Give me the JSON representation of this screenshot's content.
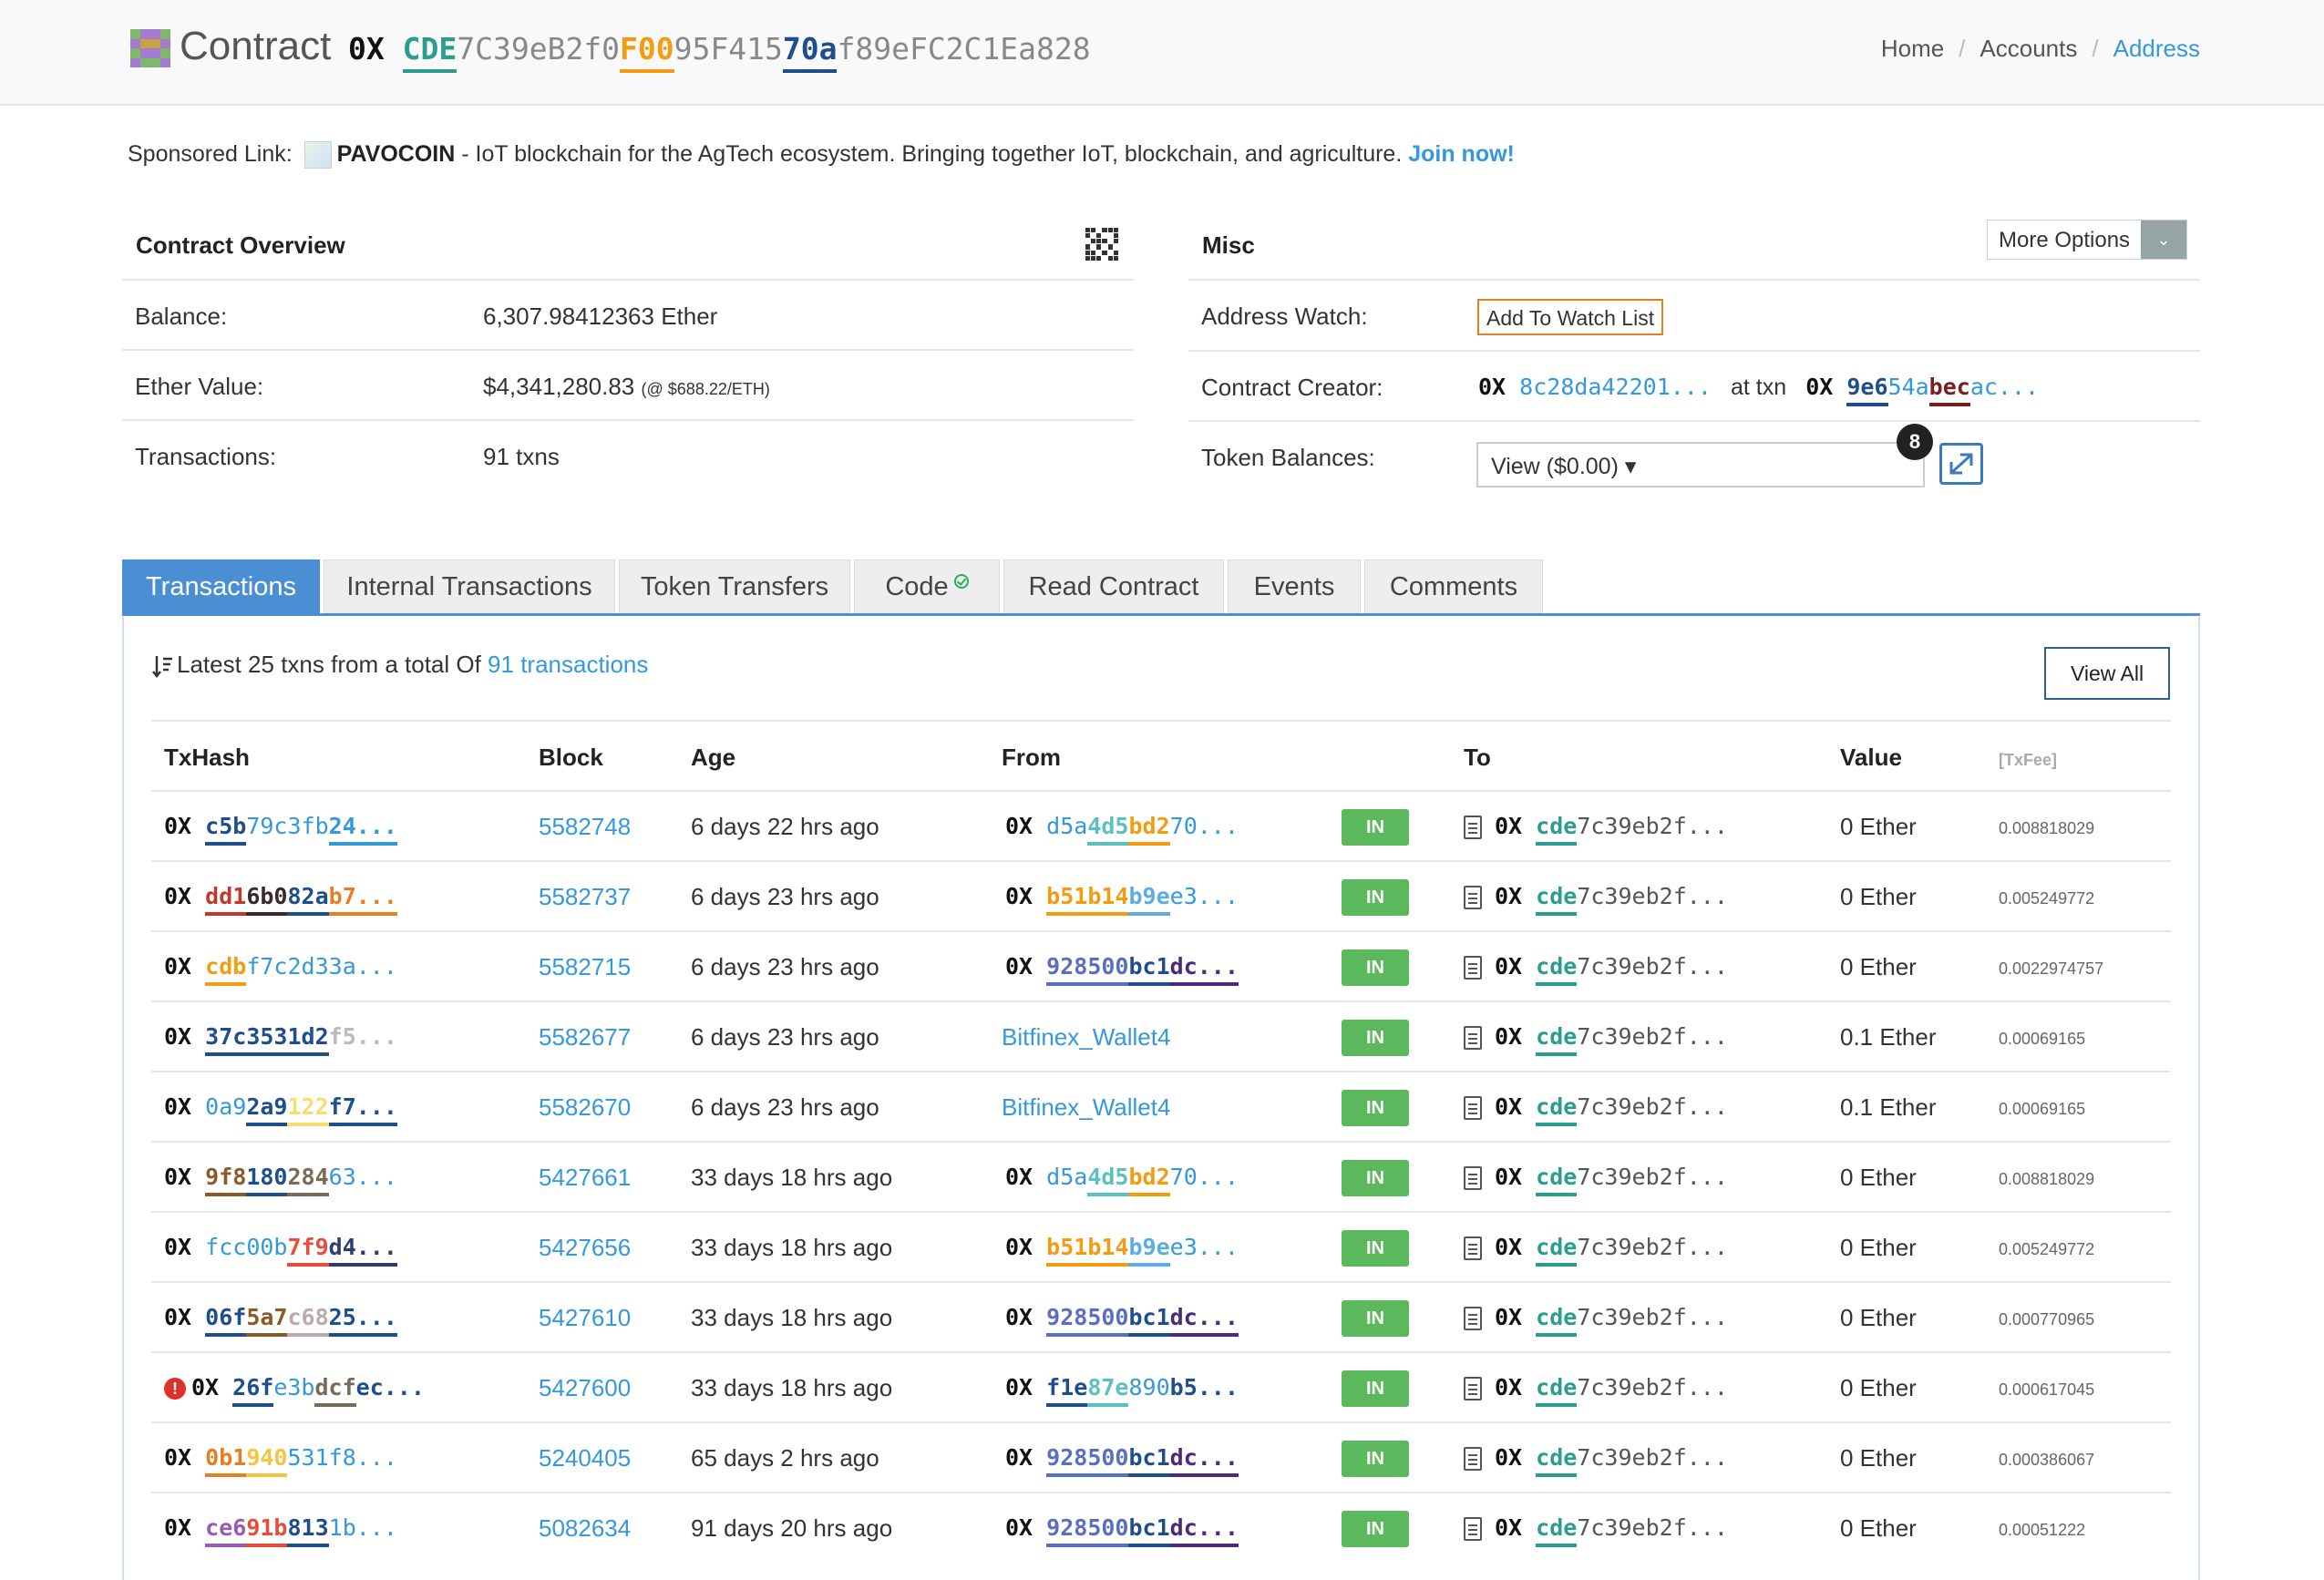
{
  "header": {
    "title": "Contract",
    "address_prefix": "0X",
    "address_segments": [
      {
        "text": "CDE",
        "color": "#2a9d8f",
        "bold": true,
        "underline": true
      },
      {
        "text": "7C39eB2f0",
        "color": "#888888",
        "bold": false,
        "underline": false
      },
      {
        "text": "F00",
        "color": "#f39c12",
        "bold": true,
        "underline": true
      },
      {
        "text": "95F415",
        "color": "#888888",
        "bold": false,
        "underline": false
      },
      {
        "text": "70a",
        "color": "#1f4e8c",
        "bold": true,
        "underline": true
      },
      {
        "text": "f89eFC2C1Ea828",
        "color": "#888888",
        "bold": false,
        "underline": false
      }
    ],
    "logo_icon": "contract-identicon",
    "breadcrumb": {
      "home": "Home",
      "accounts": "Accounts",
      "address": "Address",
      "separator": "/"
    }
  },
  "sponsored": {
    "label": "Sponsored Link:",
    "name": "PAVOCOIN",
    "text": " - IoT blockchain for the AgTech ecosystem. Bringing together IoT, blockchain, and agriculture. ",
    "cta": "Join now!"
  },
  "overview": {
    "title": "Contract Overview",
    "qr_icon": "qr-code-icon",
    "balance_label": "Balance:",
    "balance_value": "6,307.98412363 Ether",
    "ether_value_label": "Ether Value:",
    "ether_value": "$4,341,280.83",
    "ether_rate": "(@ $688.22/ETH)",
    "transactions_label": "Transactions:",
    "transactions_value": "91 txns"
  },
  "misc": {
    "title": "Misc",
    "more_options": "More Options",
    "address_watch_label": "Address Watch:",
    "watch_button": "Add To Watch List",
    "creator_label": "Contract Creator:",
    "creator_addr": [
      {
        "text": "8c2",
        "color": "#3498db",
        "bold": false,
        "underline": false
      },
      {
        "text": "8da",
        "color": "#3498db",
        "bold": false,
        "underline": false
      },
      {
        "text": "422",
        "color": "#3498db",
        "bold": false,
        "underline": false
      },
      {
        "text": "01...",
        "color": "#3498db",
        "bold": false,
        "underline": false
      }
    ],
    "at_txn": "at txn",
    "creator_txn": [
      {
        "text": "9e6",
        "color": "#1f4e8c",
        "bold": true,
        "underline": true
      },
      {
        "text": "54a",
        "color": "#3498db",
        "bold": false,
        "underline": false
      },
      {
        "text": "bec",
        "color": "#7a1f1f",
        "bold": true,
        "underline": true
      },
      {
        "text": "ac...",
        "color": "#3498db",
        "bold": false,
        "underline": false
      }
    ],
    "token_label": "Token Balances:",
    "token_value": "View ($0.00) ▾",
    "token_count": "8"
  },
  "tabs": [
    "Transactions",
    "Internal Transactions",
    "Token Transfers",
    "Code",
    "Read Contract",
    "Events",
    "Comments"
  ],
  "list": {
    "summary_prefix": "Latest 25 txns from a total Of ",
    "summary_link": "91 transactions",
    "view_all": "View All"
  },
  "table": {
    "headers": {
      "txhash": "TxHash",
      "block": "Block",
      "age": "Age",
      "from": "From",
      "to": "To",
      "value": "Value",
      "fee": "[TxFee]"
    },
    "direction_label": "IN",
    "rows": [
      {
        "error": false,
        "hash": [
          {
            "text": "c5b",
            "color": "#1f4e8c",
            "bold": true,
            "underline": true
          },
          {
            "text": "79c",
            "color": "#3498db",
            "bold": false,
            "underline": false
          },
          {
            "text": "3fb",
            "color": "#3498db",
            "bold": false,
            "underline": false
          },
          {
            "text": "24...",
            "color": "#3498db",
            "bold": true,
            "underline": true
          }
        ],
        "block": "5582748",
        "age": "6 days 22 hrs ago",
        "from_text": "",
        "from": [
          {
            "text": "d5a",
            "color": "#3498db",
            "bold": false,
            "underline": false
          },
          {
            "text": "4d5",
            "color": "#5bc0be",
            "bold": true,
            "underline": true
          },
          {
            "text": "bd2",
            "color": "#f39c12",
            "bold": true,
            "underline": true
          },
          {
            "text": "70...",
            "color": "#3498db",
            "bold": false,
            "underline": false
          }
        ],
        "value": "0 Ether",
        "fee": "0.008818029"
      },
      {
        "error": false,
        "hash": [
          {
            "text": "dd1",
            "color": "#c0392b",
            "bold": true,
            "underline": true
          },
          {
            "text": "6b0",
            "color": "#3b2a2a",
            "bold": true,
            "underline": true
          },
          {
            "text": "82a",
            "color": "#1f4e8c",
            "bold": true,
            "underline": true
          },
          {
            "text": "b7...",
            "color": "#e67e22",
            "bold": true,
            "underline": true
          }
        ],
        "block": "5582737",
        "age": "6 days 23 hrs ago",
        "from_text": "",
        "from": [
          {
            "text": "b51",
            "color": "#f39c12",
            "bold": true,
            "underline": true
          },
          {
            "text": "b14",
            "color": "#f39c12",
            "bold": true,
            "underline": true
          },
          {
            "text": "b9e",
            "color": "#5dade2",
            "bold": true,
            "underline": true
          },
          {
            "text": "e3...",
            "color": "#3498db",
            "bold": false,
            "underline": false
          }
        ],
        "value": "0 Ether",
        "fee": "0.005249772"
      },
      {
        "error": false,
        "hash": [
          {
            "text": "cdb",
            "color": "#f39c12",
            "bold": true,
            "underline": true
          },
          {
            "text": "f7c",
            "color": "#3498db",
            "bold": false,
            "underline": false
          },
          {
            "text": "2d3",
            "color": "#3498db",
            "bold": false,
            "underline": false
          },
          {
            "text": "3a...",
            "color": "#3498db",
            "bold": false,
            "underline": false
          }
        ],
        "block": "5582715",
        "age": "6 days 23 hrs ago",
        "from_text": "",
        "from": [
          {
            "text": "928",
            "color": "#5b6fc0",
            "bold": true,
            "underline": true
          },
          {
            "text": "500",
            "color": "#5b6fc0",
            "bold": true,
            "underline": true
          },
          {
            "text": "bc1",
            "color": "#1f4e8c",
            "bold": true,
            "underline": true
          },
          {
            "text": "dc...",
            "color": "#4b2a7a",
            "bold": true,
            "underline": true
          }
        ],
        "value": "0 Ether",
        "fee": "0.0022974757"
      },
      {
        "error": false,
        "hash": [
          {
            "text": "37c",
            "color": "#1f4e8c",
            "bold": true,
            "underline": true
          },
          {
            "text": "353",
            "color": "#1f4e8c",
            "bold": true,
            "underline": true
          },
          {
            "text": "1d2",
            "color": "#1f4e8c",
            "bold": true,
            "underline": true
          },
          {
            "text": "f5...",
            "color": "#bbbbbb",
            "bold": true,
            "underline": false
          }
        ],
        "block": "5582677",
        "age": "6 days 23 hrs ago",
        "from_text": "Bitfinex_Wallet4",
        "from": [],
        "value": "0.1 Ether",
        "fee": "0.00069165"
      },
      {
        "error": false,
        "hash": [
          {
            "text": "0a9",
            "color": "#3498db",
            "bold": false,
            "underline": false
          },
          {
            "text": "2a9",
            "color": "#1f4e8c",
            "bold": true,
            "underline": true
          },
          {
            "text": "122",
            "color": "#f7dc6f",
            "bold": true,
            "underline": true
          },
          {
            "text": "f7...",
            "color": "#1f4e8c",
            "bold": true,
            "underline": true
          }
        ],
        "block": "5582670",
        "age": "6 days 23 hrs ago",
        "from_text": "Bitfinex_Wallet4",
        "from": [],
        "value": "0.1 Ether",
        "fee": "0.00069165"
      },
      {
        "error": false,
        "hash": [
          {
            "text": "9f8",
            "color": "#8b5a2b",
            "bold": true,
            "underline": true
          },
          {
            "text": "180",
            "color": "#1f4e8c",
            "bold": true,
            "underline": true
          },
          {
            "text": "284",
            "color": "#7a6a5a",
            "bold": true,
            "underline": true
          },
          {
            "text": "63...",
            "color": "#3498db",
            "bold": false,
            "underline": false
          }
        ],
        "block": "5427661",
        "age": "33 days 18 hrs ago",
        "from_text": "",
        "from": [
          {
            "text": "d5a",
            "color": "#3498db",
            "bold": false,
            "underline": false
          },
          {
            "text": "4d5",
            "color": "#5bc0be",
            "bold": true,
            "underline": true
          },
          {
            "text": "bd2",
            "color": "#f39c12",
            "bold": true,
            "underline": true
          },
          {
            "text": "70...",
            "color": "#3498db",
            "bold": false,
            "underline": false
          }
        ],
        "value": "0 Ether",
        "fee": "0.008818029"
      },
      {
        "error": false,
        "hash": [
          {
            "text": "fcc",
            "color": "#3498db",
            "bold": false,
            "underline": false
          },
          {
            "text": "00b",
            "color": "#3498db",
            "bold": false,
            "underline": false
          },
          {
            "text": "7f9",
            "color": "#e74c3c",
            "bold": true,
            "underline": true
          },
          {
            "text": "d4...",
            "color": "#2c3e70",
            "bold": true,
            "underline": true
          }
        ],
        "block": "5427656",
        "age": "33 days 18 hrs ago",
        "from_text": "",
        "from": [
          {
            "text": "b51",
            "color": "#f39c12",
            "bold": true,
            "underline": true
          },
          {
            "text": "b14",
            "color": "#f39c12",
            "bold": true,
            "underline": true
          },
          {
            "text": "b9e",
            "color": "#5dade2",
            "bold": true,
            "underline": true
          },
          {
            "text": "e3...",
            "color": "#3498db",
            "bold": false,
            "underline": false
          }
        ],
        "value": "0 Ether",
        "fee": "0.005249772"
      },
      {
        "error": false,
        "hash": [
          {
            "text": "06f",
            "color": "#1f4e8c",
            "bold": true,
            "underline": true
          },
          {
            "text": "5a7",
            "color": "#8b5a2b",
            "bold": true,
            "underline": true
          },
          {
            "text": "c68",
            "color": "#bbaaaa",
            "bold": true,
            "underline": true
          },
          {
            "text": "25...",
            "color": "#1f4e8c",
            "bold": true,
            "underline": true
          }
        ],
        "block": "5427610",
        "age": "33 days 18 hrs ago",
        "from_text": "",
        "from": [
          {
            "text": "928",
            "color": "#5b6fc0",
            "bold": true,
            "underline": true
          },
          {
            "text": "500",
            "color": "#5b6fc0",
            "bold": true,
            "underline": true
          },
          {
            "text": "bc1",
            "color": "#1f4e8c",
            "bold": true,
            "underline": true
          },
          {
            "text": "dc...",
            "color": "#4b2a7a",
            "bold": true,
            "underline": true
          }
        ],
        "value": "0 Ether",
        "fee": "0.000770965"
      },
      {
        "error": true,
        "hash": [
          {
            "text": "26f",
            "color": "#1f4e8c",
            "bold": true,
            "underline": true
          },
          {
            "text": "e3b",
            "color": "#3498db",
            "bold": false,
            "underline": false
          },
          {
            "text": "dcf",
            "color": "#7a6a5a",
            "bold": true,
            "underline": true
          },
          {
            "text": "ec...",
            "color": "#1f4e8c",
            "bold": true,
            "underline": false
          }
        ],
        "block": "5427600",
        "age": "33 days 18 hrs ago",
        "from_text": "",
        "from": [
          {
            "text": "f1e",
            "color": "#1f4e8c",
            "bold": true,
            "underline": true
          },
          {
            "text": "87e",
            "color": "#5bc0be",
            "bold": true,
            "underline": true
          },
          {
            "text": "890",
            "color": "#3498db",
            "bold": false,
            "underline": false
          },
          {
            "text": "b5...",
            "color": "#1f4e8c",
            "bold": true,
            "underline": false
          }
        ],
        "value": "0 Ether",
        "fee": "0.000617045"
      },
      {
        "error": false,
        "hash": [
          {
            "text": "0b1",
            "color": "#e67e22",
            "bold": true,
            "underline": true
          },
          {
            "text": "940",
            "color": "#f4c542",
            "bold": true,
            "underline": true
          },
          {
            "text": "531",
            "color": "#3498db",
            "bold": false,
            "underline": false
          },
          {
            "text": "f8...",
            "color": "#3498db",
            "bold": false,
            "underline": false
          }
        ],
        "block": "5240405",
        "age": "65 days 2 hrs ago",
        "from_text": "",
        "from": [
          {
            "text": "928",
            "color": "#5b6fc0",
            "bold": true,
            "underline": true
          },
          {
            "text": "500",
            "color": "#5b6fc0",
            "bold": true,
            "underline": true
          },
          {
            "text": "bc1",
            "color": "#1f4e8c",
            "bold": true,
            "underline": true
          },
          {
            "text": "dc...",
            "color": "#4b2a7a",
            "bold": true,
            "underline": true
          }
        ],
        "value": "0 Ether",
        "fee": "0.000386067"
      },
      {
        "error": false,
        "hash": [
          {
            "text": "ce6",
            "color": "#9b59b6",
            "bold": true,
            "underline": true
          },
          {
            "text": "91b",
            "color": "#e74c3c",
            "bold": true,
            "underline": true
          },
          {
            "text": "813",
            "color": "#1f4e8c",
            "bold": true,
            "underline": true
          },
          {
            "text": "1b...",
            "color": "#3498db",
            "bold": false,
            "underline": false
          }
        ],
        "block": "5082634",
        "age": "91 days 20 hrs ago",
        "from_text": "",
        "from": [
          {
            "text": "928",
            "color": "#5b6fc0",
            "bold": true,
            "underline": true
          },
          {
            "text": "500",
            "color": "#5b6fc0",
            "bold": true,
            "underline": true
          },
          {
            "text": "bc1",
            "color": "#1f4e8c",
            "bold": true,
            "underline": true
          },
          {
            "text": "dc...",
            "color": "#4b2a7a",
            "bold": true,
            "underline": true
          }
        ],
        "value": "0 Ether",
        "fee": "0.00051222"
      }
    ],
    "to_addr": [
      {
        "text": "cde",
        "color": "#2a9d8f",
        "bold": true,
        "underline": true
      },
      {
        "text": "7c3",
        "color": "#555555",
        "bold": false,
        "underline": false
      },
      {
        "text": "9eb",
        "color": "#555555",
        "bold": false,
        "underline": false
      },
      {
        "text": "2f...",
        "color": "#555555",
        "bold": false,
        "underline": false
      }
    ]
  }
}
